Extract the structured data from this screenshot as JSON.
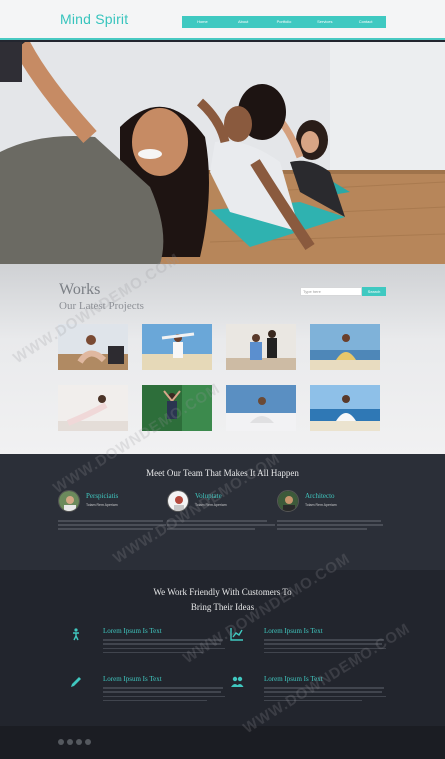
{
  "header": {
    "logo": "Mind Spirit",
    "nav": [
      "Home",
      "About",
      "Portfolio",
      "Services",
      "Contact"
    ]
  },
  "works": {
    "title": "Works",
    "subtitle": "Our Latest Projects",
    "search_placeholder": "Type here",
    "search_button": "Search"
  },
  "team": {
    "heading": "Meet Our Team That Makes It All Happen",
    "members": [
      {
        "name": "Perspiciatis",
        "role": "Totam Rem Aperiam"
      },
      {
        "name": "Voluptate",
        "role": "Totam Rem Aperiam"
      },
      {
        "name": "Architecto",
        "role": "Totam Rem Aperiam"
      }
    ]
  },
  "customers": {
    "heading_line1": "We Work Friendly With Customers To",
    "heading_line2": "Bring Their Ideas",
    "features": [
      {
        "title": "Lorem Ipsum Is Text",
        "icon": "figure-icon"
      },
      {
        "title": "Lorem Ipsum Is Text",
        "icon": "chart-icon"
      },
      {
        "title": "Lorem Ipsum Is Text",
        "icon": "pencil-icon"
      },
      {
        "title": "Lorem Ipsum Is Text",
        "icon": "users-icon"
      }
    ]
  },
  "footer": {
    "social_icons": [
      "facebook-icon",
      "twitter-icon",
      "google-icon",
      "dribbble-icon"
    ]
  },
  "watermark": "WWW.DOWNDEMO.COM",
  "colors": {
    "accent": "#3fc9c1",
    "dark": "#2b2f38"
  }
}
